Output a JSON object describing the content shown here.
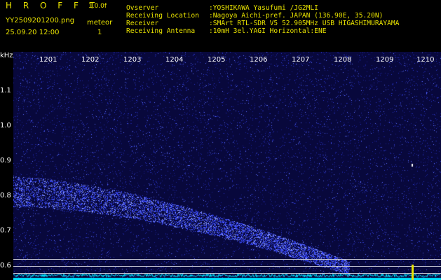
{
  "header": {
    "brand": "H R O F F T",
    "version": "1.0.0f",
    "filename": "YY2509201200.png",
    "mode": "meteor",
    "timestamp": "25.09.20 12:00",
    "count": "1"
  },
  "info": [
    {
      "key": "Ovserver",
      "value": ":YOSHIKAWA Yasufumi /JG2MLI"
    },
    {
      "key": "Receiving Location",
      "value": ":Nagoya Aichi-pref. JAPAN (136.90E, 35.20N)"
    },
    {
      "key": "Receiver",
      "value": ":SMArt RTL-SDR V5 52.905MHz USB HIGASHIMURAYAMA"
    },
    {
      "key": "Receiving Antenna",
      "value": ":10mH 3el.YAGI Horizontal:ENE"
    }
  ],
  "axis": {
    "y_unit": "kHz",
    "y_ticks": [
      "1.1",
      "1.0",
      "0.9",
      "0.8",
      "0.7",
      "0.6"
    ],
    "x_ticks": [
      "1201",
      "1202",
      "1203",
      "1204",
      "1205",
      "1206",
      "1207",
      "1208",
      "1209",
      "1210"
    ]
  },
  "colors": {
    "background": "#000000",
    "header_text": "#e8e200",
    "waterfall_bg": "#08083c",
    "noise": "#3a4aff",
    "signal": "#8fa0ff",
    "spectrum": "#00e5ff"
  }
}
